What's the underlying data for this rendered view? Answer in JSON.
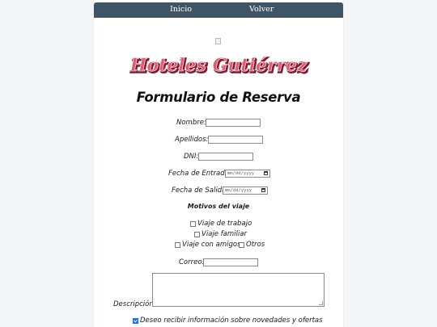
{
  "nav": {
    "home_label": "Inicio",
    "back_label": "Volver"
  },
  "brand": {
    "logo_text": "Hoteles Gutiérrez"
  },
  "form": {
    "title": "Formulario de Reserva",
    "fields": {
      "name_label": "Nombre:",
      "surname_label": "Apellidos:",
      "dni_label": "DNI:",
      "checkin_label": "Fecha de Entrada:",
      "checkin_placeholder": "mm/dd/yyyy",
      "checkout_label": "Fecha de Salida:",
      "checkout_placeholder": "mm/dd/yyyy",
      "email_label": "Correo:",
      "description_label": "Descripción:"
    },
    "reasons": {
      "title": "Motivos del viaje",
      "options": [
        "Viaje de trabajo",
        "Viaje familiar",
        "Viaje con amigos",
        "Otros"
      ]
    },
    "newsletter": {
      "label": "Deseo recibir información sobre novedades y ofertas",
      "checked": true
    }
  },
  "colors": {
    "nav_bg": "#3f5465",
    "logo_fill": "#e8556f",
    "checkbox_accent": "#1a73e8"
  },
  "icons": {
    "date_picker": "calendar-icon",
    "logo_placeholder": "broken-image-icon"
  }
}
